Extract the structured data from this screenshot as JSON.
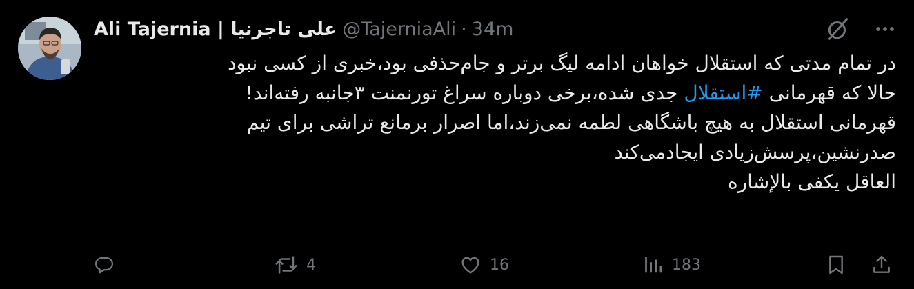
{
  "tweet": {
    "display_name": "Ali Tajernia | علی تاجرنیا",
    "handle": "@TajerniaAli",
    "separator": "·",
    "time": "34m",
    "body_lines": [
      "در تمام مدتی که استقلال خواهان ادامه لیگ برتر و جام‌حذفی بود،خبری از کسی نبود",
      [
        "حالا که قهرمانی ",
        "#استقلال",
        " جدی شده،برخی دوباره سراغ تورنمنت ۳جانبه رفته‌اند!"
      ],
      "قهرمانی استقلال به هیچ باشگاهی لطمه نمی‌زند،اما اصرار برمانع تراشی برای تیم",
      "صدرنشین،پرسش‌زیادی ایجادمی‌کند",
      "العاقل یکفی بالإشاره"
    ]
  },
  "body": {
    "line1": "در تمام مدتی که استقلال خواهان ادامه لیگ برتر و جام‌حذفی بود،خبری از کسی نبود",
    "line2_before": "حالا که قهرمانی ",
    "line2_hashtag": "#استقلال",
    "line2_after": " جدی شده،برخی دوباره سراغ تورنمنت ۳جانبه رفته‌اند!",
    "line3": "قهرمانی استقلال به هیچ باشگاهی لطمه نمی‌زند،اما اصرار برمانع تراشی برای تیم",
    "line4": "صدرنشین،پرسش‌زیادی ایجادمی‌کند",
    "line5": "العاقل یکفی بالإشاره"
  },
  "actions": {
    "reply_count": "",
    "retweet_count": "4",
    "like_count": "16",
    "views_count": "183"
  },
  "icons": {
    "top": [
      "grok-icon",
      "more-icon"
    ],
    "actions": [
      "reply-icon",
      "retweet-icon",
      "like-icon",
      "views-icon",
      "bookmark-icon",
      "share-icon"
    ]
  },
  "colors": {
    "background": "#000000",
    "text": "#e7e9ea",
    "secondary": "#71767b",
    "link": "#1d9bf0"
  }
}
